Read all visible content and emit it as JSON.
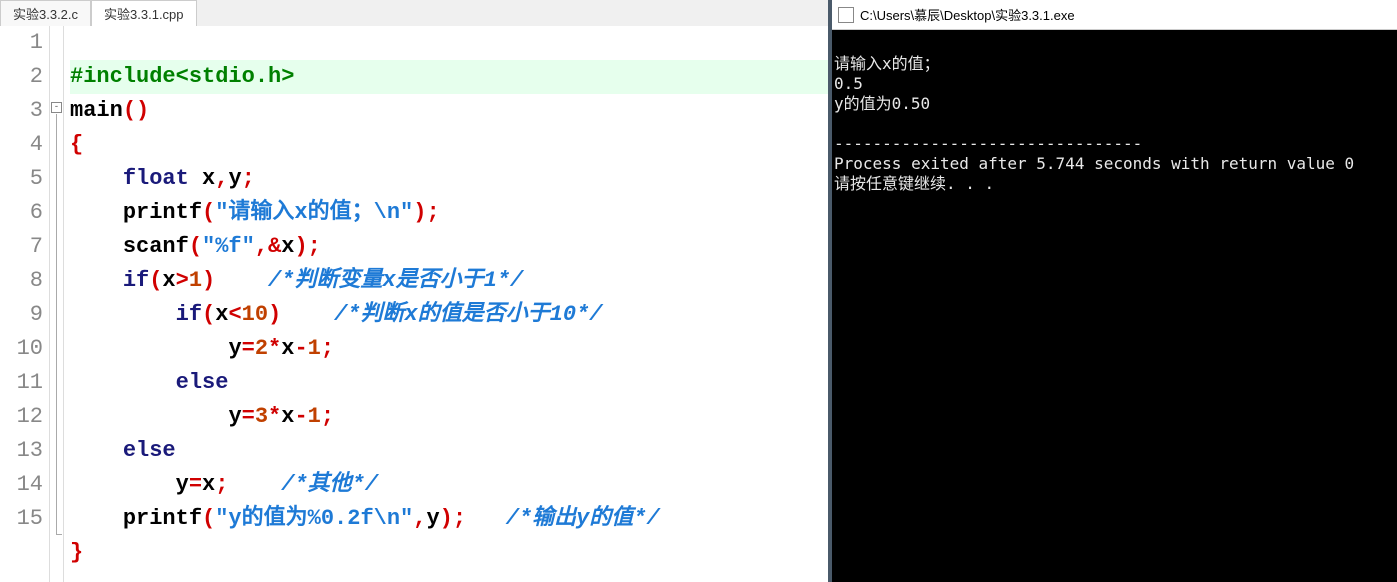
{
  "tabs": [
    {
      "label": "实验3.3.2.c",
      "active": false
    },
    {
      "label": "实验3.3.1.cpp",
      "active": true
    }
  ],
  "lines": {
    "l1": {
      "pp": "#include<stdio.h>"
    },
    "l2": {
      "fn": "main",
      "paren": "()"
    },
    "l3": {
      "br": "{"
    },
    "l4": {
      "kw": "float",
      "vars": " x",
      "comma": ",",
      "vars2": "y",
      "semi": ";"
    },
    "l5": {
      "fn": "printf",
      "paren_o": "(",
      "str": "\"请输入x的值；\\n\"",
      "paren_c": ")",
      "semi": ";"
    },
    "l6": {
      "fn": "scanf",
      "paren_o": "(",
      "str": "\"%f\"",
      "comma": ",",
      "amp": "&",
      "var": "x",
      "paren_c": ")",
      "semi": ";"
    },
    "l7": {
      "kw": "if",
      "paren_o": "(",
      "var": "x",
      "op": ">",
      "num": "1",
      "paren_c": ")",
      "cm": "/*判断变量x是否小于1*/"
    },
    "l8": {
      "kw": "if",
      "paren_o": "(",
      "var": "x",
      "op": "<",
      "num": "10",
      "paren_c": ")",
      "cm": "/*判断x的值是否小于10*/"
    },
    "l9": {
      "var": "y",
      "op1": "=",
      "num1": "2",
      "op2": "*",
      "var2": "x",
      "op3": "-",
      "num2": "1",
      "semi": ";"
    },
    "l10": {
      "kw": "else"
    },
    "l11": {
      "var": "y",
      "op1": "=",
      "num1": "3",
      "op2": "*",
      "var2": "x",
      "op3": "-",
      "num2": "1",
      "semi": ";"
    },
    "l12": {
      "kw": "else"
    },
    "l13": {
      "var": "y",
      "op": "=",
      "var2": "x",
      "semi": ";",
      "cm": "/*其他*/"
    },
    "l14": {
      "fn": "printf",
      "paren_o": "(",
      "str": "\"y的值为%0.2f\\n\"",
      "comma": ",",
      "var": "y",
      "paren_c": ")",
      "semi": ";",
      "cm": "/*输出y的值*/"
    },
    "l15": {
      "br": "}"
    }
  },
  "gutter": [
    "1",
    "2",
    "3",
    "4",
    "5",
    "6",
    "7",
    "8",
    "9",
    "10",
    "11",
    "12",
    "13",
    "14",
    "15"
  ],
  "console": {
    "title": "C:\\Users\\慕辰\\Desktop\\实验3.3.1.exe",
    "lines": [
      "请输入x的值；",
      "0.5",
      "y的值为0.50",
      "",
      "--------------------------------",
      "Process exited after 5.744 seconds with return value 0",
      "请按任意键继续. . ."
    ]
  }
}
